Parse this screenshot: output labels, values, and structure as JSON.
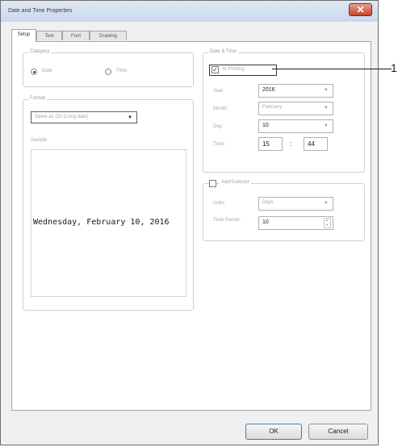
{
  "window": {
    "title": "Date and Time Properties",
    "close_glyph": "✕",
    "close_color": "#c7432a"
  },
  "tabs": [
    {
      "label": "Setup",
      "active": true
    },
    {
      "label": "Text"
    },
    {
      "label": "Font"
    },
    {
      "label": "Drawing"
    }
  ],
  "category": {
    "label": "Category",
    "options": [
      {
        "label": "Date",
        "selected": true
      },
      {
        "label": "Time",
        "selected": false
      }
    ]
  },
  "format": {
    "label": "Format",
    "selected": "Same as OS (Long date)"
  },
  "sample": {
    "label": "Sample",
    "text": "Wednesday, February 10, 2016"
  },
  "date_time": {
    "label": "Date & Time",
    "at_printing": {
      "label": "At Printing",
      "checked": true,
      "mark": "✓"
    },
    "year": {
      "label": "Year:",
      "value": "2016"
    },
    "month": {
      "label": "Month:",
      "value": "February"
    },
    "day": {
      "label": "Day:",
      "value": "10"
    },
    "time": {
      "label": "Time:",
      "hour": "15",
      "separator": ":",
      "minute": "44"
    }
  },
  "add_subtract": {
    "label": "Add/Subtract",
    "checked": false,
    "units": {
      "label": "Units:",
      "value": "Days"
    },
    "time_period": {
      "label": "Time Period:",
      "value": "10"
    }
  },
  "buttons": {
    "ok": "OK",
    "cancel": "Cancel"
  },
  "callout": {
    "number": "1"
  },
  "icons": {
    "dropdown": "▼",
    "spin_up": "▲",
    "spin_down": "▼"
  }
}
